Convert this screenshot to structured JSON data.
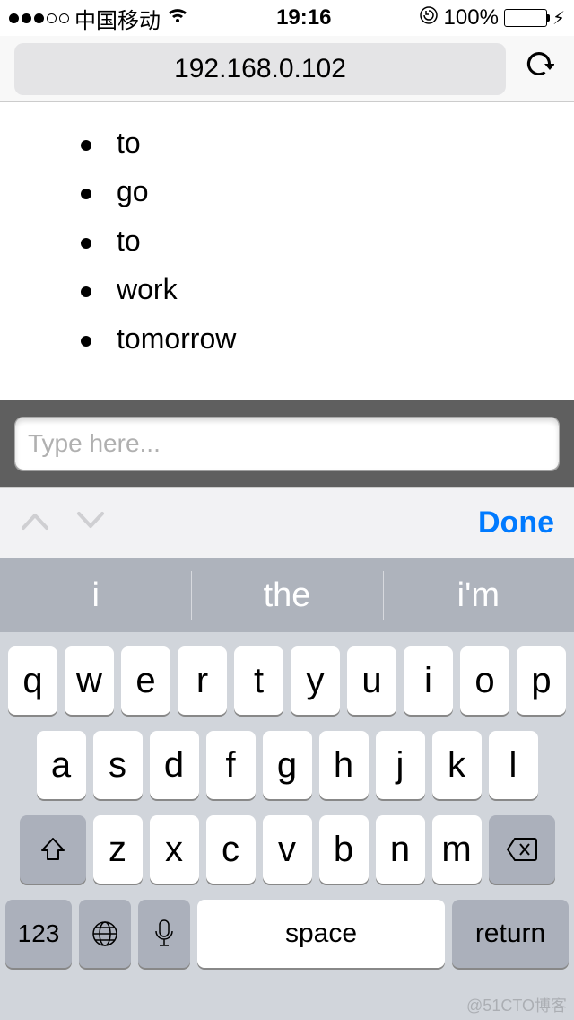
{
  "status": {
    "carrier": "中国移动",
    "time": "19:16",
    "battery_pct": "100%"
  },
  "url_bar": {
    "address": "192.168.0.102"
  },
  "page": {
    "items": [
      "to",
      "go",
      "to",
      "work",
      "tomorrow"
    ]
  },
  "input": {
    "placeholder": "Type here...",
    "value": ""
  },
  "assist": {
    "done": "Done"
  },
  "suggestions": [
    "i",
    "the",
    "i'm"
  ],
  "keyboard": {
    "row1": [
      "q",
      "w",
      "e",
      "r",
      "t",
      "y",
      "u",
      "i",
      "o",
      "p"
    ],
    "row2": [
      "a",
      "s",
      "d",
      "f",
      "g",
      "h",
      "j",
      "k",
      "l"
    ],
    "row3": [
      "z",
      "x",
      "c",
      "v",
      "b",
      "n",
      "m"
    ],
    "numbers_label": "123",
    "space_label": "space",
    "return_label": "return"
  },
  "watermark": "@51CTO博客"
}
